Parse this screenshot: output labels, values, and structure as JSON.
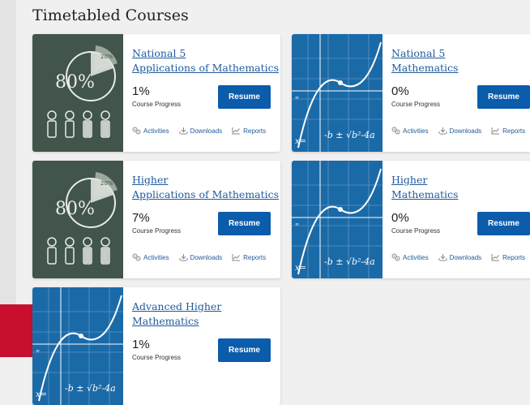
{
  "page": {
    "section_title": "Timetabled Courses"
  },
  "common": {
    "progress_label": "Course Progress",
    "resume_label": "Resume",
    "activities_label": "Activities",
    "downloads_label": "Downloads",
    "reports_label": "Reports"
  },
  "courses": [
    {
      "title_line1": "National 5",
      "title_line2": "Applications of Mathematics",
      "progress": "1%",
      "thumbnail": "chalkboard-pie-chart"
    },
    {
      "title_line1": "National 5",
      "title_line2": "Mathematics",
      "progress": "0%",
      "thumbnail": "blue-graph-formula"
    },
    {
      "title_line1": "Higher",
      "title_line2": "Applications of Mathematics",
      "progress": "7%",
      "thumbnail": "chalkboard-pie-chart"
    },
    {
      "title_line1": "Higher",
      "title_line2": "Mathematics",
      "progress": "0%",
      "thumbnail": "blue-graph-formula"
    },
    {
      "title_line1": "Advanced Higher",
      "title_line2": "Mathematics",
      "progress": "1%",
      "thumbnail": "blue-graph-formula"
    }
  ],
  "colors": {
    "link": "#1f5a9c",
    "button": "#0b5cab",
    "chalkboard": "#41554b",
    "blueboard": "#1b6aa8",
    "brand_red": "#c8102e"
  }
}
